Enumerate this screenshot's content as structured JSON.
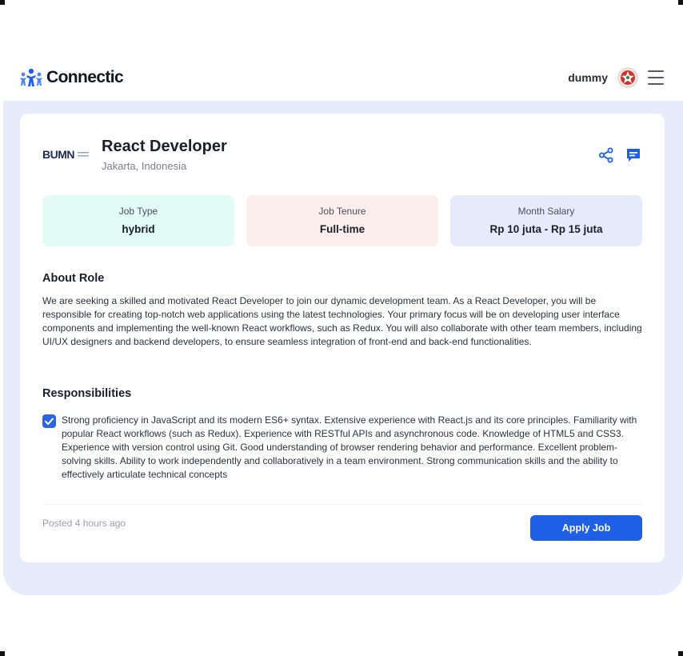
{
  "app": {
    "brand_name": "Connectic",
    "username": "dummy"
  },
  "job": {
    "company_logo_text": "BUMN",
    "title": "React Developer",
    "location": "Jakarta, Indonesia",
    "info": {
      "type_label": "Job Type",
      "type_value": "hybrid",
      "tenure_label": "Job Tenure",
      "tenure_value": "Full-time",
      "salary_label": "Month Salary",
      "salary_value": "Rp 10 juta - Rp 15 juta"
    },
    "about_title": "About Role",
    "about_text": "We are seeking a skilled and motivated React Developer to join our dynamic development team. As a React Developer, you will be responsible for creating top-notch web applications using the latest technologies. Your primary focus will be on developing user interface components and implementing the well-known React workflows, such as Redux. You will also collaborate with other team members, including UI/UX designers and backend developers, to ensure seamless integration of front-end and back-end functionalities.",
    "responsibilities_title": "Responsibilities",
    "responsibilities_text": "Strong proficiency in JavaScript and its modern ES6+ syntax. Extensive experience with React.js and its core principles. Familiarity with popular React workflows (such as Redux). Experience with RESTful APIs and asynchronous code. Knowledge of HTML5 and CSS3. Experience with version control using Git. Good understanding of browser rendering behavior and performance. Excellent problem-solving skills. Ability to work independently and collaboratively in a team environment. Strong communication skills and the ability to effectively articulate technical concepts",
    "posted": "Posted 4 hours ago",
    "apply_label": "Apply Job"
  },
  "icons": {
    "logo": "people-logo-icon",
    "avatar": "avatar",
    "menu": "hamburger-menu-icon",
    "share": "share-icon",
    "chat": "chat-icon",
    "check": "checkbox-checked-icon"
  },
  "colors": {
    "primary": "#1f5fe6",
    "panel": "#e6ecfc",
    "job_type_bg": "#e3fbf7",
    "job_tenure_bg": "#fdeeee",
    "salary_bg": "#e6ebfc"
  }
}
